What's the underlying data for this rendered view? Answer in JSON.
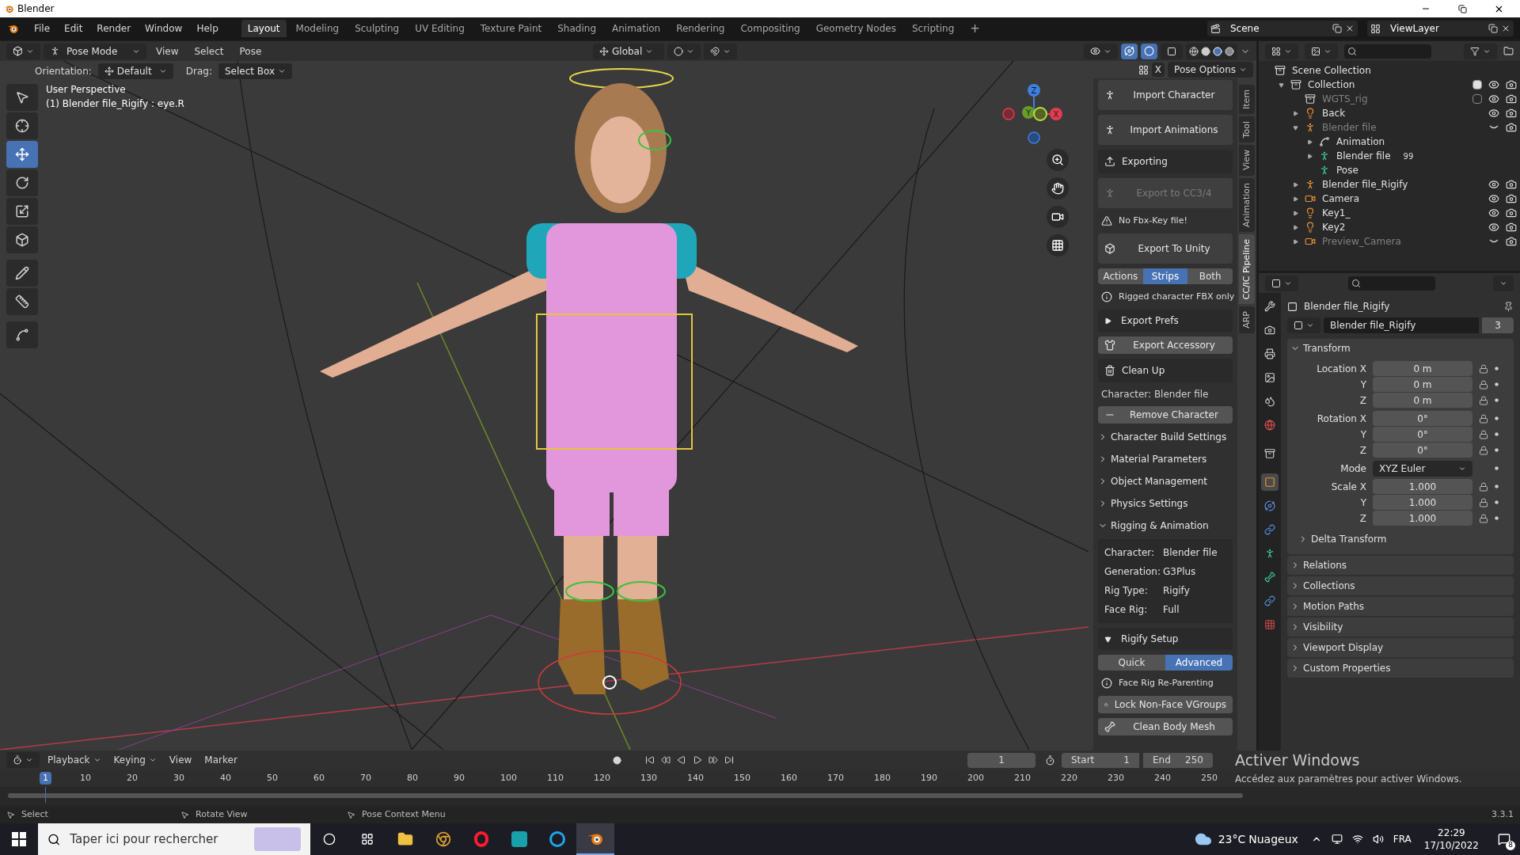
{
  "window": {
    "title": "Blender"
  },
  "menu": [
    "File",
    "Edit",
    "Render",
    "Window",
    "Help"
  ],
  "workspaces": [
    {
      "label": "Layout",
      "selected": true
    },
    {
      "label": "Modeling",
      "selected": false
    },
    {
      "label": "Sculpting",
      "selected": false
    },
    {
      "label": "UV Editing",
      "selected": false
    },
    {
      "label": "Texture Paint",
      "selected": false
    },
    {
      "label": "Shading",
      "selected": false
    },
    {
      "label": "Animation",
      "selected": false
    },
    {
      "label": "Rendering",
      "selected": false
    },
    {
      "label": "Compositing",
      "selected": false
    },
    {
      "label": "Geometry Nodes",
      "selected": false
    },
    {
      "label": "Scripting",
      "selected": false
    }
  ],
  "add_workspace": "+",
  "scene": "Scene",
  "view_layer": "ViewLayer",
  "viewport": {
    "mode": "Pose Mode",
    "menus": [
      "View",
      "Select",
      "Pose"
    ],
    "transform_orientation": "Global",
    "orientation_label": "Orientation:",
    "orientation": "Default",
    "drag_label": "Drag:",
    "drag": "Select Box",
    "close": "X",
    "pose_options": "Pose Options",
    "info": [
      "User Perspective",
      "(1) Blender file_Rigify : eye.R"
    ],
    "tools": [
      {
        "kind": "select",
        "selected": false
      },
      {
        "kind": "cursor",
        "selected": false
      },
      {
        "kind": "move",
        "selected": true
      },
      {
        "kind": "rotate",
        "selected": false
      },
      {
        "kind": "scale",
        "selected": false
      },
      {
        "kind": "transform",
        "selected": false
      },
      {
        "kind": "annotate",
        "selected": false
      },
      {
        "kind": "measure",
        "selected": false
      },
      {
        "kind": "relax",
        "selected": false
      }
    ],
    "axes": [
      "Z",
      "Y",
      "X"
    ]
  },
  "sidebar_tabs": [
    {
      "label": "Item",
      "selected": false
    },
    {
      "label": "Tool",
      "selected": false
    },
    {
      "label": "View",
      "selected": false
    },
    {
      "label": "Animation",
      "selected": false
    },
    {
      "label": "CC/IC Pipeline",
      "selected": true
    },
    {
      "label": "ARP",
      "selected": false
    }
  ],
  "cc_panel": [
    {
      "kind": "button",
      "label": "Import Character",
      "disabled": false
    },
    {
      "kind": "button",
      "label": "Import Animations",
      "disabled": false
    },
    {
      "kind": "action",
      "label": "Exporting",
      "disabled": false
    },
    {
      "kind": "button",
      "label": "Export to CC3/4",
      "disabled": true
    },
    {
      "kind": "warning",
      "label": "No Fbx-Key file!"
    },
    {
      "kind": "button",
      "label": "Export To Unity",
      "disabled": false
    },
    {
      "kind": "segmented",
      "options": [
        {
          "label": "Actions",
          "selected": false
        },
        {
          "label": "Strips",
          "selected": true
        },
        {
          "label": "Both",
          "selected": false
        }
      ]
    },
    {
      "kind": "info",
      "label": "Rigged character FBX only"
    },
    {
      "kind": "subpanel",
      "label": "Export Prefs",
      "expanded": false
    },
    {
      "kind": "small",
      "label": "Export Accessory",
      "disabled": false
    },
    {
      "kind": "action",
      "label": "Clean Up",
      "disabled": false
    },
    {
      "kind": "text",
      "label": "Character: Blender file"
    },
    {
      "kind": "small",
      "label": "Remove Character",
      "disabled": false
    },
    {
      "kind": "panel",
      "label": "Character Build Settings",
      "expanded": false
    },
    {
      "kind": "panel",
      "label": "Material Parameters",
      "expanded": false
    },
    {
      "kind": "panel",
      "label": "Object Management",
      "expanded": false
    },
    {
      "kind": "panel",
      "label": "Physics Settings",
      "expanded": false
    },
    {
      "kind": "panel",
      "label": "Rigging & Animation",
      "expanded": true
    },
    {
      "kind": "table",
      "rows": [
        [
          "Character:",
          "Blender file"
        ],
        [
          "Generation:",
          "G3Plus"
        ],
        [
          "Rig Type:",
          "Rigify"
        ],
        [
          "Face Rig:",
          "Full"
        ]
      ]
    },
    {
      "kind": "subpanel",
      "label": "Rigify Setup",
      "expanded": true
    },
    {
      "kind": "segmented",
      "options": [
        {
          "label": "Quick",
          "selected": false
        },
        {
          "label": "Advanced",
          "selected": true
        }
      ]
    },
    {
      "kind": "info",
      "label": "Face Rig Re-Parenting"
    },
    {
      "kind": "small",
      "label": "Lock Non-Face VGroups",
      "disabled": false
    },
    {
      "kind": "small",
      "label": "Clean Body Mesh",
      "disabled": false
    }
  ],
  "outliner": {
    "root": "Scene Collection",
    "items": [
      {
        "name": "Collection",
        "kind": "collection",
        "expanded": true,
        "checked": true,
        "hidden": false,
        "children": [
          {
            "name": "WGTS_rig",
            "kind": "collection",
            "checked": false,
            "hidden": false,
            "dim": true
          },
          {
            "name": "Back",
            "kind": "light",
            "expanded": false,
            "hidden": false,
            "dim": false
          },
          {
            "name": "Blender file",
            "kind": "armature",
            "expanded": true,
            "hidden": true,
            "dim": true,
            "children": [
              {
                "name": "Animation",
                "kind": "action",
                "expanded": false
              },
              {
                "name": "Blender file",
                "kind": "armature_data",
                "expanded": false,
                "badge": "99"
              },
              {
                "name": "Pose",
                "kind": "pose"
              }
            ]
          },
          {
            "name": "Blender file_Rigify",
            "kind": "armature",
            "expanded": false,
            "hidden": false,
            "dim": false
          },
          {
            "name": "Camera",
            "kind": "camera",
            "expanded": false,
            "hidden": false,
            "dim": false
          },
          {
            "name": "Key1_",
            "kind": "light",
            "expanded": false,
            "hidden": false,
            "dim": false
          },
          {
            "name": "Key2",
            "kind": "light",
            "expanded": false,
            "hidden": false,
            "dim": false
          },
          {
            "name": "Preview_Camera",
            "kind": "camera",
            "expanded": false,
            "hidden": true,
            "dim": true
          }
        ]
      }
    ]
  },
  "properties": {
    "object": "Blender file_Rigify",
    "data_name": "Blender file_Rigify",
    "users": "3",
    "tabs": [
      {
        "kind": "tool",
        "selected": false
      },
      {
        "kind": "render",
        "selected": false
      },
      {
        "kind": "output",
        "selected": false
      },
      {
        "kind": "view_layer",
        "selected": false
      },
      {
        "kind": "scene",
        "selected": false
      },
      {
        "kind": "world",
        "selected": false
      },
      {
        "kind": "collection",
        "selected": false
      },
      {
        "kind": "object",
        "selected": true
      },
      {
        "kind": "physics",
        "selected": false
      },
      {
        "kind": "constraints",
        "selected": false
      },
      {
        "kind": "data",
        "selected": false
      },
      {
        "kind": "bone",
        "selected": false
      },
      {
        "kind": "bone_constraints",
        "selected": false
      },
      {
        "kind": "texture",
        "selected": false
      }
    ],
    "transform": {
      "label": "Transform",
      "expanded": true,
      "groups": [
        [
          {
            "kind": "field",
            "label": "Location X",
            "value": "0 m"
          },
          {
            "kind": "field",
            "label": "Y",
            "value": "0 m"
          },
          {
            "kind": "field",
            "label": "Z",
            "value": "0 m"
          }
        ],
        [
          {
            "kind": "field",
            "label": "Rotation X",
            "value": "0°"
          },
          {
            "kind": "field",
            "label": "Y",
            "value": "0°"
          },
          {
            "kind": "field",
            "label": "Z",
            "value": "0°"
          }
        ],
        [
          {
            "kind": "dropdown",
            "label": "Mode",
            "value": "XYZ Euler"
          }
        ],
        [
          {
            "kind": "field",
            "label": "Scale X",
            "value": "1.000"
          },
          {
            "kind": "field",
            "label": "Y",
            "value": "1.000"
          },
          {
            "kind": "field",
            "label": "Z",
            "value": "1.000"
          }
        ]
      ],
      "sub": {
        "label": "Delta Transform",
        "expanded": false
      }
    },
    "panels": [
      {
        "label": "Relations",
        "expanded": false
      },
      {
        "label": "Collections",
        "expanded": false
      },
      {
        "label": "Motion Paths",
        "expanded": false
      },
      {
        "label": "Visibility",
        "expanded": false
      },
      {
        "label": "Viewport Display",
        "expanded": false
      },
      {
        "label": "Custom Properties",
        "expanded": false
      }
    ]
  },
  "timeline": {
    "menus": [
      "Playback",
      "Keying",
      "View",
      "Marker"
    ],
    "current_frame": "1",
    "start_label": "Start",
    "start": "1",
    "end_label": "End",
    "end": "250",
    "ticks": [
      "1",
      "10",
      "20",
      "30",
      "40",
      "50",
      "60",
      "70",
      "80",
      "90",
      "100",
      "110",
      "120",
      "130",
      "140",
      "150",
      "160",
      "170",
      "180",
      "190",
      "200",
      "210",
      "220",
      "230",
      "240",
      "250"
    ]
  },
  "status_bar": {
    "hints": [
      "Select",
      "Rotate View",
      "Pose Context Menu"
    ],
    "version": "3.3.1"
  },
  "activation": {
    "title": "Activer Windows",
    "text": "Accédez aux paramètres pour activer Windows."
  },
  "taskbar": {
    "search_placeholder": "Taper ici pour rechercher",
    "temperature": "23°C",
    "weather": "Nuageux",
    "language": "FRA",
    "time": "22:29",
    "date": "17/10/2022",
    "notifications": "8"
  }
}
